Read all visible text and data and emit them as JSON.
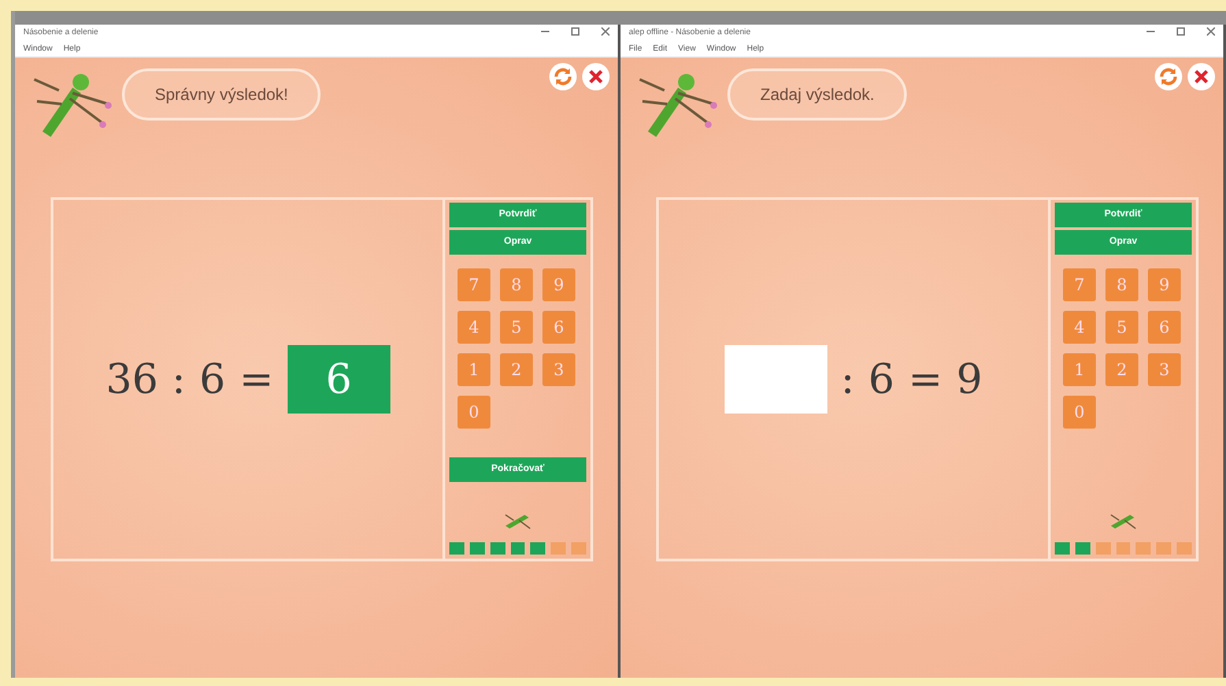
{
  "windows": [
    {
      "title": "Násobenie a delenie",
      "menu": [
        "Window",
        "Help"
      ],
      "bubble": "Správny výsledok!",
      "equation": [
        {
          "kind": "number",
          "text": "36"
        },
        {
          "kind": "op",
          "text": ":"
        },
        {
          "kind": "number",
          "text": "6"
        },
        {
          "kind": "op",
          "text": "="
        },
        {
          "kind": "answer",
          "text": "6",
          "correct": true
        }
      ],
      "buttons": [
        "Potvrdiť",
        "Oprav"
      ],
      "keys": [
        "7",
        "8",
        "9",
        "4",
        "5",
        "6",
        "1",
        "2",
        "3",
        "0"
      ],
      "continue_button": "Pokračovať",
      "progress": [
        {
          "done": true
        },
        {
          "done": true
        },
        {
          "done": true
        },
        {
          "done": true
        },
        {
          "done": true
        },
        {
          "done": false
        },
        {
          "done": false
        }
      ]
    },
    {
      "title": "alep offline - Násobenie a delenie",
      "menu": [
        "File",
        "Edit",
        "View",
        "Window",
        "Help"
      ],
      "bubble": "Zadaj výsledok.",
      "equation": [
        {
          "kind": "answer",
          "correct": false
        },
        {
          "kind": "op",
          "text": ":"
        },
        {
          "kind": "number",
          "text": "6"
        },
        {
          "kind": "op",
          "text": "="
        },
        {
          "kind": "number",
          "text": "9"
        }
      ],
      "buttons": [
        "Potvrdiť",
        "Oprav"
      ],
      "keys": [
        "7",
        "8",
        "9",
        "4",
        "5",
        "6",
        "1",
        "2",
        "3",
        "0"
      ],
      "progress": [
        {
          "done": true
        },
        {
          "done": true
        },
        {
          "done": false
        },
        {
          "done": false
        },
        {
          "done": false
        },
        {
          "done": false
        },
        {
          "done": false
        }
      ]
    }
  ]
}
